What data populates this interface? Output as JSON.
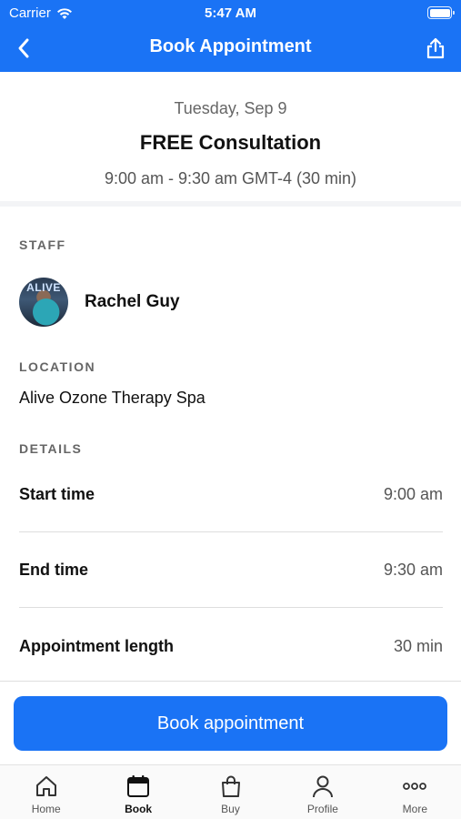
{
  "status_bar": {
    "carrier": "Carrier",
    "time": "5:47 AM"
  },
  "nav": {
    "title": "Book Appointment",
    "back_icon": "chevron-left-icon",
    "share_icon": "share-icon"
  },
  "summary": {
    "date": "Tuesday, Sep 9",
    "service": "FREE Consultation",
    "time_range": "9:00 am - 9:30 am GMT-4 (30 min)"
  },
  "staff": {
    "label": "STAFF",
    "name": "Rachel Guy",
    "avatar_text": "ALIVE"
  },
  "location": {
    "label": "LOCATION",
    "value": "Alive Ozone Therapy Spa"
  },
  "details": {
    "label": "DETAILS",
    "rows": [
      {
        "label": "Start time",
        "value": "9:00 am"
      },
      {
        "label": "End time",
        "value": "9:30 am"
      },
      {
        "label": "Appointment length",
        "value": "30 min"
      }
    ]
  },
  "book_button": {
    "label": "Book appointment"
  },
  "tabs": [
    {
      "label": "Home",
      "icon": "home-icon",
      "active": false
    },
    {
      "label": "Book",
      "icon": "calendar-icon",
      "active": true
    },
    {
      "label": "Buy",
      "icon": "shopping-bag-icon",
      "active": false
    },
    {
      "label": "Profile",
      "icon": "person-icon",
      "active": false
    },
    {
      "label": "More",
      "icon": "more-icon",
      "active": false
    }
  ],
  "colors": {
    "accent": "#1a73f5"
  }
}
